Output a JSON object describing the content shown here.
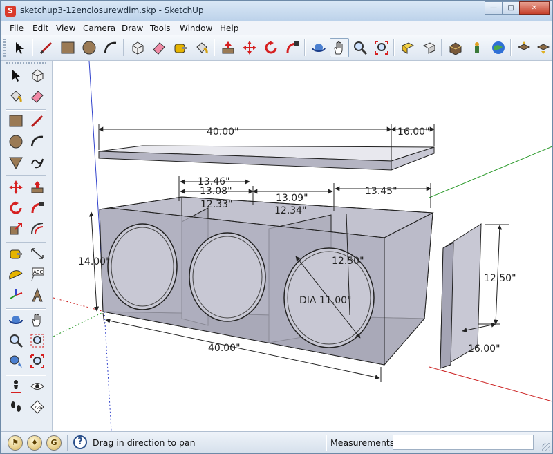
{
  "window": {
    "title": "sketchup3-12enclosurewdim.skp - SketchUp",
    "app_icon_glyph": "S",
    "minimize_glyph": "—",
    "maximize_glyph": "□",
    "close_glyph": "✕"
  },
  "menu": [
    "File",
    "Edit",
    "View",
    "Camera",
    "Draw",
    "Tools",
    "Window",
    "Help"
  ],
  "toolbar_icons": [
    "select-icon",
    "line-icon",
    "rectangle-icon",
    "circle-icon",
    "arc-icon",
    "make-component-icon",
    "eraser-icon",
    "tape-measure-icon",
    "paint-bucket-icon",
    "push-pull-icon",
    "move-icon",
    "rotate-icon",
    "follow-me-icon",
    "orbit-icon",
    "pan-icon",
    "zoom-icon",
    "zoom-extents-icon",
    "previous-view-icon",
    "next-view-icon",
    "3d-warehouse-icon",
    "component-icon",
    "google-earth-icon",
    "share-model-icon",
    "get-model-icon"
  ],
  "left_toolbar_icons": [
    "select-icon",
    "make-component-icon",
    "paint-bucket-icon",
    "eraser-icon",
    "rectangle-icon",
    "line-icon",
    "circle-icon",
    "arc-icon",
    "polygon-icon",
    "freehand-icon",
    "move-icon",
    "push-pull-icon",
    "rotate-icon",
    "follow-me-icon",
    "scale-icon",
    "offset-icon",
    "tape-measure-icon",
    "dimension-icon",
    "protractor-icon",
    "text-icon",
    "axes-icon",
    "3d-text-icon",
    "orbit-icon",
    "pan-icon",
    "zoom-icon",
    "zoom-window-icon",
    "previous-view-icon",
    "zoom-extents-icon",
    "walk-icon",
    "look-around-icon",
    "position-camera-icon",
    "section-plane-icon"
  ],
  "dimensions": {
    "lid_width": "40.00\"",
    "lid_depth": "16.00\"",
    "top_13_46": "13.46\"",
    "top_13_08": "13.08\"",
    "top_13_09": "13.09\"",
    "top_13_45": "13.45\"",
    "inner_12_33": "12.33\"",
    "inner_12_34": "12.34\"",
    "height_14": "14.00\"",
    "inner_height": "12.50\"",
    "hole_dia": "DIA 11.00\"",
    "bottom_width": "40.00\"",
    "panel_height": "12.50\"",
    "panel_depth": "16.00\""
  },
  "colors": {
    "axis_red": "#cc2222",
    "axis_green": "#2a9a2a",
    "axis_blue": "#3344cc",
    "glass_fill": "#a9a9b8",
    "edge": "#2a2a2a"
  },
  "status": {
    "message": "Drag in direction to pan",
    "help_glyph": "?",
    "measurements_label": "Measurements",
    "measurements_value": ""
  }
}
